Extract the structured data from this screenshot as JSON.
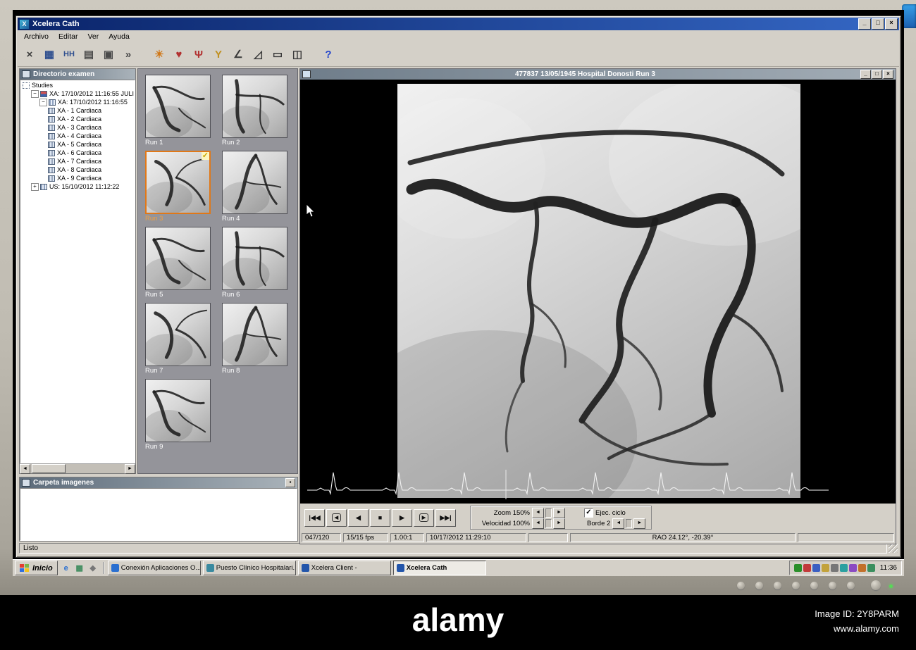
{
  "glyphs": {
    "check": "✓",
    "arrow_left": "◄",
    "arrow_right": "►",
    "scroll_left": "◄",
    "scroll_right": "►",
    "minimize": "_",
    "maximize": "□",
    "close": "×",
    "panel_collapse": "▪"
  },
  "titlebar": {
    "title": "Xcelera Cath",
    "controls": [
      {
        "name": "minimize-button",
        "glyph": "_"
      },
      {
        "name": "maximize-button",
        "glyph": "□"
      },
      {
        "name": "close-button",
        "glyph": "×"
      }
    ]
  },
  "menubar": {
    "items": [
      "Archivo",
      "Editar",
      "Ver",
      "Ayuda"
    ]
  },
  "toolbar": {
    "buttons": [
      {
        "name": "delete-button",
        "glyph": "×",
        "color": "#3a3a3a"
      },
      {
        "name": "save-button",
        "glyph": "▦",
        "color": "#2f4f8f"
      },
      {
        "name": "study-manager-button",
        "glyph": "HH",
        "color": "#2f4f8f"
      },
      {
        "name": "copy-button",
        "glyph": "▤",
        "color": "#4a4a4a"
      },
      {
        "name": "print-button",
        "glyph": "▣",
        "color": "#4a4a4a"
      },
      {
        "name": "export-button",
        "glyph": "»",
        "color": "#4a4a4a"
      },
      {
        "name": "brightness-button",
        "glyph": "☀",
        "color": "#d07818",
        "gap": true
      },
      {
        "name": "lv-analysis-button",
        "glyph": "♥",
        "color": "#b23030"
      },
      {
        "name": "coronary-analysis-button",
        "glyph": "Ψ",
        "color": "#b23030"
      },
      {
        "name": "vessel-analysis-button",
        "glyph": "Y",
        "color": "#c09020"
      },
      {
        "name": "angle-measure-button",
        "glyph": "∠",
        "color": "#3a3a3a"
      },
      {
        "name": "caliper-button",
        "glyph": "◿",
        "color": "#3a3a3a"
      },
      {
        "name": "display-settings-button",
        "glyph": "▭",
        "color": "#3a3a3a"
      },
      {
        "name": "frame-tools-button",
        "glyph": "◫",
        "color": "#3a3a3a"
      },
      {
        "name": "help-button",
        "glyph": "?",
        "color": "#2244cc",
        "gap": true
      }
    ]
  },
  "directory": {
    "title": "Directorio examen",
    "items": [
      {
        "level": 0,
        "icon": "root",
        "label": "Studies"
      },
      {
        "level": 1,
        "expander": "-",
        "icon": "patient",
        "label": "XA: 17/10/2012 11:16:55",
        "suffix": "JULI"
      },
      {
        "level": 2,
        "expander": "-",
        "icon": "series",
        "label": "XA: 17/10/2012 11:16:55"
      },
      {
        "level": 3,
        "icon": "film",
        "label": "XA - 1 Cardiaca"
      },
      {
        "level": 3,
        "icon": "film",
        "label": "XA - 2 Cardiaca"
      },
      {
        "level": 3,
        "icon": "film",
        "label": "XA - 3 Cardiaca"
      },
      {
        "level": 3,
        "icon": "film",
        "label": "XA - 4 Cardiaca"
      },
      {
        "level": 3,
        "icon": "film",
        "label": "XA - 5 Cardiaca"
      },
      {
        "level": 3,
        "icon": "film",
        "label": "XA - 6 Cardiaca"
      },
      {
        "level": 3,
        "icon": "film",
        "label": "XA - 7 Cardiaca"
      },
      {
        "level": 3,
        "icon": "film",
        "label": "XA - 8 Cardiaca"
      },
      {
        "level": 3,
        "icon": "film",
        "label": "XA - 9 Cardiaca"
      },
      {
        "level": 1,
        "expander": "+",
        "icon": "series",
        "label": "US: 15/10/2012 11:12:22"
      }
    ]
  },
  "thumbnails": {
    "runs": [
      {
        "label": "Run 1"
      },
      {
        "label": "Run 2"
      },
      {
        "label": "Run 3",
        "selected": true
      },
      {
        "label": "Run 4"
      },
      {
        "label": "Run 5"
      },
      {
        "label": "Run 6"
      },
      {
        "label": "Run 7"
      },
      {
        "label": "Run 8"
      },
      {
        "label": "Run 9"
      }
    ]
  },
  "carpeta": {
    "title": "Carpeta imagenes"
  },
  "viewer": {
    "title": "477837 13/05/1945 Hospital Donosti Run 3",
    "playback": [
      {
        "name": "goto-first-button",
        "glyph": "|◀◀"
      },
      {
        "name": "step-back-button",
        "glyph": "◀",
        "boxed": true
      },
      {
        "name": "play-reverse-button",
        "glyph": "◀"
      },
      {
        "name": "stop-button",
        "glyph": "■"
      },
      {
        "name": "play-button",
        "glyph": "▶"
      },
      {
        "name": "step-forward-button",
        "glyph": "▶",
        "boxed": true
      },
      {
        "name": "goto-last-button",
        "glyph": "▶▶|"
      }
    ],
    "zoom_label": "Zoom 150%",
    "velocidad_label": "Velocidad 100%",
    "ejec_label": "Ejec. ciclo",
    "ejec_checked": true,
    "borde_label": "Borde 2",
    "status": {
      "frames": "047/120",
      "fps": "15/15 fps",
      "ratio": "1.00:1",
      "datetime": "10/17/2012 11:29:10",
      "angle": "RAO 24.12°, -20.39°"
    }
  },
  "statusbar": {
    "text": "Listo"
  },
  "taskbar": {
    "start": "Inicio",
    "quick_launch": [
      {
        "name": "ie-shortcut",
        "glyph": "e",
        "color": "#2a6fd0"
      },
      {
        "name": "desktop-shortcut",
        "glyph": "▦",
        "color": "#3a8a5a"
      },
      {
        "name": "app-shortcut",
        "glyph": "◆",
        "color": "#777777"
      }
    ],
    "tasks": [
      {
        "label": "Conexión Aplicaciones O...",
        "icon_color": "#2a6fd0"
      },
      {
        "label": "Puesto Clínico Hospitalari...",
        "icon_color": "#3a8aa0"
      },
      {
        "label": "Xcelera Client -",
        "icon_color": "#2255aa"
      },
      {
        "label": "Xcelera Cath",
        "icon_color": "#2255aa",
        "active": true
      }
    ],
    "tray_icons": [
      {
        "name": "tray-icon-1",
        "color": "#2a8f2a"
      },
      {
        "name": "tray-icon-2",
        "color": "#c23a3a"
      },
      {
        "name": "tray-icon-3",
        "color": "#3a5fc2"
      },
      {
        "name": "tray-icon-4",
        "color": "#c2a23a"
      },
      {
        "name": "tray-icon-5",
        "color": "#777777"
      },
      {
        "name": "tray-icon-6",
        "color": "#2aa0a0"
      },
      {
        "name": "tray-icon-7",
        "color": "#8a4ac2"
      },
      {
        "name": "tray-icon-8",
        "color": "#c2702a"
      },
      {
        "name": "tray-icon-9",
        "color": "#3a8f5f"
      }
    ],
    "time": "11:36"
  },
  "watermark": {
    "brand": "alamy",
    "image_id": "Image ID: 2Y8PARM",
    "site": "www.alamy.com"
  }
}
